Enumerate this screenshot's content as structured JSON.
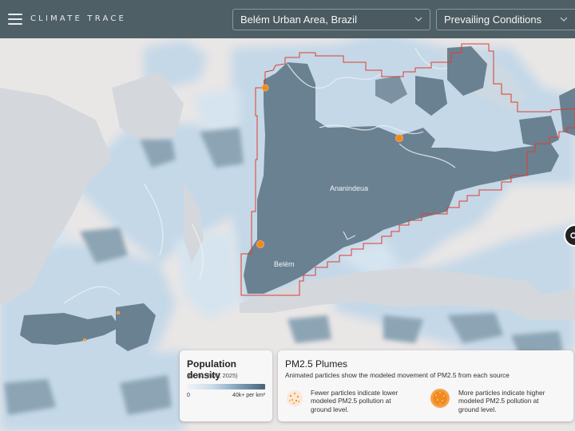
{
  "app": {
    "logo_text": "CLIMATE TRACE",
    "menu_icon": "hamburger-menu-icon"
  },
  "header": {
    "location_select": {
      "value": "Belém Urban Area, Brazil",
      "icon": "chevron-down-icon"
    },
    "view_select": {
      "value": "Prevailing Conditions",
      "icon": "chevron-down-icon"
    }
  },
  "map": {
    "labels": {
      "ananindeua": "Ananindeua",
      "belem": "Belém"
    },
    "colors": {
      "land": "#e9e6e6",
      "water": "#d3d7db",
      "density_low": "#c3d8e9",
      "density_high": "#5f7583",
      "boundary": "#e23b2e",
      "source_marker": "#f08a1c"
    },
    "source_markers": 5,
    "zoom_control_icon": "zoom-control-icon"
  },
  "population_legend": {
    "title": "Population density",
    "subtitle": "(GHSL-POP, 2025)",
    "min_label": "0",
    "max_label": "40k+ per km²"
  },
  "pm25_legend": {
    "title": "PM2.5 Plumes",
    "description": "Animated particles show the modeled movement of PM2.5 from each source",
    "fewer_text": "Fewer particles indicate lower modeled PM2.5 pollution at ground level.",
    "more_text": "More particles indicate higher modeled PM2.5 pollution at ground level."
  }
}
